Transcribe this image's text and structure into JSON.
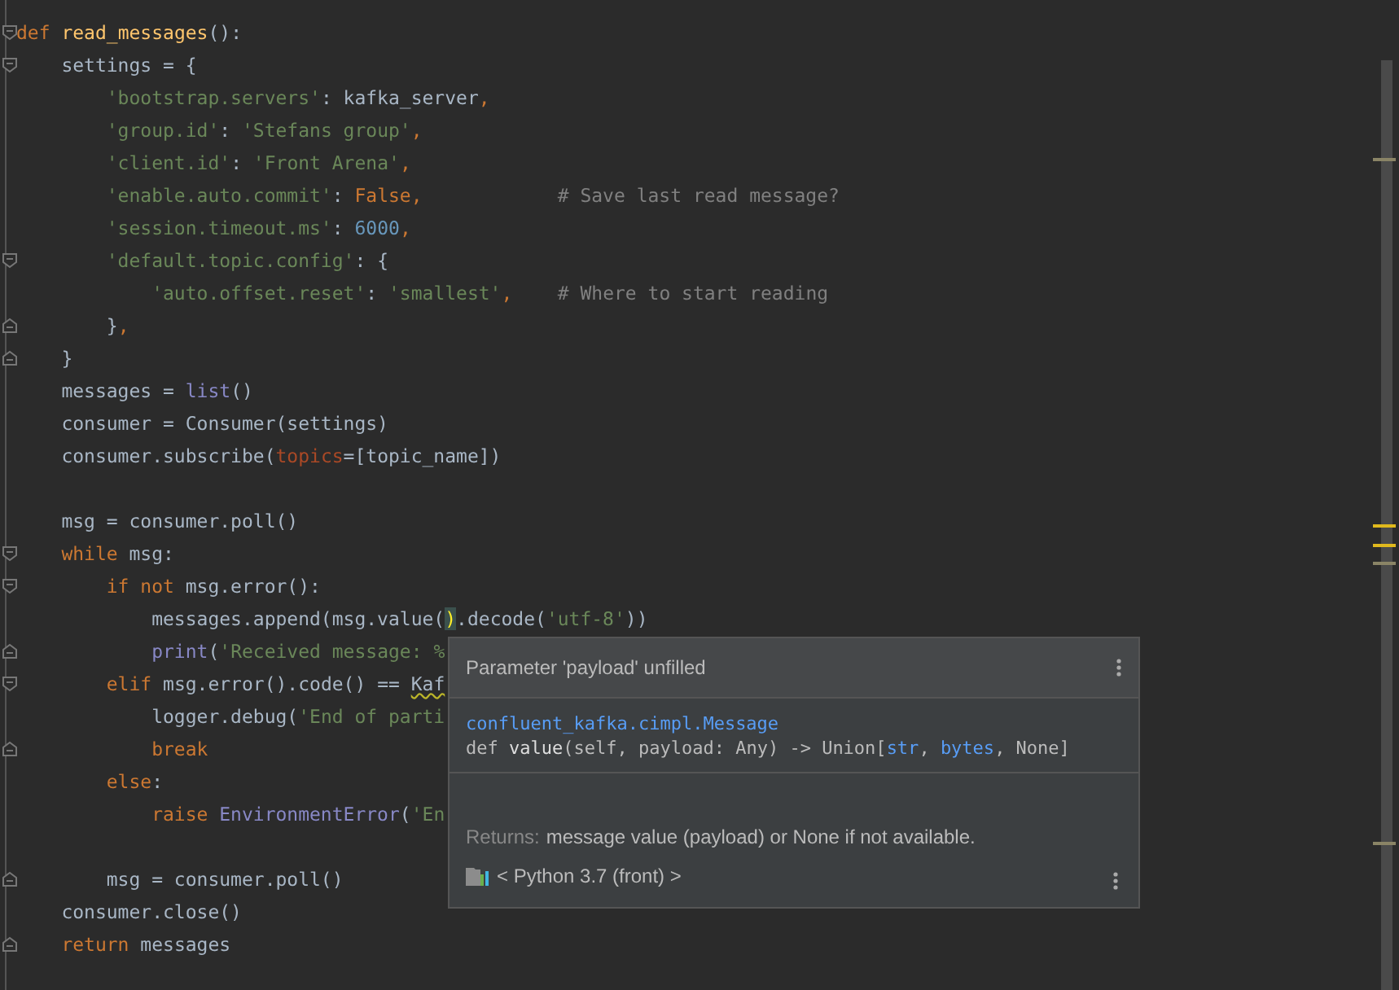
{
  "editor": {
    "lines": [
      {
        "fold_start": true,
        "tokens": [
          {
            "kind": "kw",
            "text": "def "
          },
          {
            "kind": "fn",
            "text": "read_messages"
          },
          {
            "kind": "plain",
            "text": "():"
          }
        ]
      },
      {
        "fold_start": true,
        "tokens": [
          {
            "kind": "plain",
            "text": "    settings = {"
          }
        ]
      },
      {
        "tokens": [
          {
            "kind": "str",
            "text": "        'bootstrap.servers'"
          },
          {
            "kind": "plain",
            "text": ": kafka_server"
          },
          {
            "kind": "kw",
            "text": ","
          }
        ]
      },
      {
        "tokens": [
          {
            "kind": "str",
            "text": "        'group.id'"
          },
          {
            "kind": "plain",
            "text": ": "
          },
          {
            "kind": "str",
            "text": "'Stefans group'"
          },
          {
            "kind": "kw",
            "text": ","
          }
        ]
      },
      {
        "tokens": [
          {
            "kind": "str",
            "text": "        'client.id'"
          },
          {
            "kind": "plain",
            "text": ": "
          },
          {
            "kind": "str",
            "text": "'Front Arena'"
          },
          {
            "kind": "kw",
            "text": ","
          }
        ]
      },
      {
        "tokens": [
          {
            "kind": "str",
            "text": "        'enable.auto.commit'"
          },
          {
            "kind": "plain",
            "text": ": "
          },
          {
            "kind": "kw",
            "text": "False,"
          },
          {
            "kind": "comment",
            "text": "            # Save last read message?"
          }
        ]
      },
      {
        "tokens": [
          {
            "kind": "str",
            "text": "        'session.timeout.ms'"
          },
          {
            "kind": "plain",
            "text": ": "
          },
          {
            "kind": "num",
            "text": "6000"
          },
          {
            "kind": "kw",
            "text": ","
          }
        ]
      },
      {
        "fold_start": true,
        "tokens": [
          {
            "kind": "str",
            "text": "        'default.topic.config'"
          },
          {
            "kind": "plain",
            "text": ": {"
          }
        ]
      },
      {
        "tokens": [
          {
            "kind": "str",
            "text": "            'auto.offset.reset'"
          },
          {
            "kind": "plain",
            "text": ": "
          },
          {
            "kind": "str",
            "text": "'smallest'"
          },
          {
            "kind": "kw",
            "text": ","
          },
          {
            "kind": "comment",
            "text": "    # Where to start reading"
          }
        ]
      },
      {
        "fold_end": true,
        "tokens": [
          {
            "kind": "plain",
            "text": "        }"
          },
          {
            "kind": "kw",
            "text": ","
          }
        ]
      },
      {
        "fold_end": true,
        "tokens": [
          {
            "kind": "plain",
            "text": "    }"
          }
        ]
      },
      {
        "tokens": [
          {
            "kind": "plain",
            "text": "    messages = "
          },
          {
            "kind": "builtin",
            "text": "list"
          },
          {
            "kind": "plain",
            "text": "()"
          }
        ]
      },
      {
        "tokens": [
          {
            "kind": "plain",
            "text": "    consumer = Consumer(settings)"
          }
        ]
      },
      {
        "tokens": [
          {
            "kind": "plain",
            "text": "    consumer.subscribe("
          },
          {
            "kind": "param",
            "text": "topics"
          },
          {
            "kind": "plain",
            "text": "=[topic_name])"
          }
        ]
      },
      {
        "blank_before": true,
        "tokens": [
          {
            "kind": "plain",
            "text": "    msg = consumer.poll()"
          }
        ]
      },
      {
        "fold_start": true,
        "tokens": [
          {
            "kind": "kw",
            "text": "    while "
          },
          {
            "kind": "plain",
            "text": "msg:"
          }
        ]
      },
      {
        "fold_start": true,
        "tokens": [
          {
            "kind": "kw",
            "text": "        if not "
          },
          {
            "kind": "plain",
            "text": "msg.error():"
          }
        ]
      },
      {
        "tokens": [
          {
            "kind": "plain",
            "text": "            messages.append(msg.value("
          },
          {
            "kind": "match",
            "text": ")"
          },
          {
            "kind": "plain",
            "text": ".decode("
          },
          {
            "kind": "str",
            "text": "'utf-8'"
          },
          {
            "kind": "plain",
            "text": "))"
          }
        ]
      },
      {
        "fold_end": true,
        "tokens": [
          {
            "kind": "builtin",
            "text": "            print"
          },
          {
            "kind": "plain",
            "text": "("
          },
          {
            "kind": "str",
            "text": "'Received message: %"
          }
        ]
      },
      {
        "fold_start": true,
        "tokens": [
          {
            "kind": "kw",
            "text": "        elif "
          },
          {
            "kind": "plain",
            "text": "msg.error().code() == "
          },
          {
            "kind": "warn",
            "text": "Kaf"
          }
        ]
      },
      {
        "tokens": [
          {
            "kind": "plain",
            "text": "            logger.debug("
          },
          {
            "kind": "str",
            "text": "'End of parti"
          }
        ]
      },
      {
        "fold_end": true,
        "tokens": [
          {
            "kind": "kw",
            "text": "            break"
          }
        ]
      },
      {
        "tokens": [
          {
            "kind": "kw",
            "text": "        else"
          },
          {
            "kind": "plain",
            "text": ":"
          }
        ]
      },
      {
        "tokens": [
          {
            "kind": "kw",
            "text": "            raise "
          },
          {
            "kind": "builtin",
            "text": "EnvironmentError"
          },
          {
            "kind": "plain",
            "text": "("
          },
          {
            "kind": "str",
            "text": "'En"
          }
        ]
      },
      {
        "blank_before": true,
        "fold_end": true,
        "tokens": [
          {
            "kind": "plain",
            "text": "        msg = consumer.poll()"
          }
        ]
      },
      {
        "tokens": [
          {
            "kind": "plain",
            "text": "    consumer.close()"
          }
        ]
      },
      {
        "fold_end": true,
        "tokens": [
          {
            "kind": "kw",
            "text": "    return "
          },
          {
            "kind": "plain",
            "text": "messages"
          }
        ]
      }
    ]
  },
  "scrollbar": {
    "marks": [
      {
        "color": "#8a8466"
      },
      {
        "color": "#e0b91d"
      },
      {
        "color": "#e0b91d"
      },
      {
        "color": "#8a8466"
      },
      {
        "color": "#8a8466"
      }
    ]
  },
  "popup": {
    "header": "Parameter 'payload' unfilled",
    "class_path": "confluent_kafka.cimpl.Message",
    "signature": [
      {
        "kind": "plain",
        "text": "def "
      },
      {
        "kind": "bold",
        "text": "value"
      },
      {
        "kind": "plain",
        "text": "(self, payload: Any) -> Union["
      },
      {
        "kind": "link",
        "text": "str"
      },
      {
        "kind": "plain",
        "text": ", "
      },
      {
        "kind": "link",
        "text": "bytes"
      },
      {
        "kind": "plain",
        "text": ", None]"
      }
    ],
    "returns_label": "Returns:",
    "returns_text": "message value (payload) or None if not available.",
    "library": "< Python 3.7 (front) >"
  }
}
